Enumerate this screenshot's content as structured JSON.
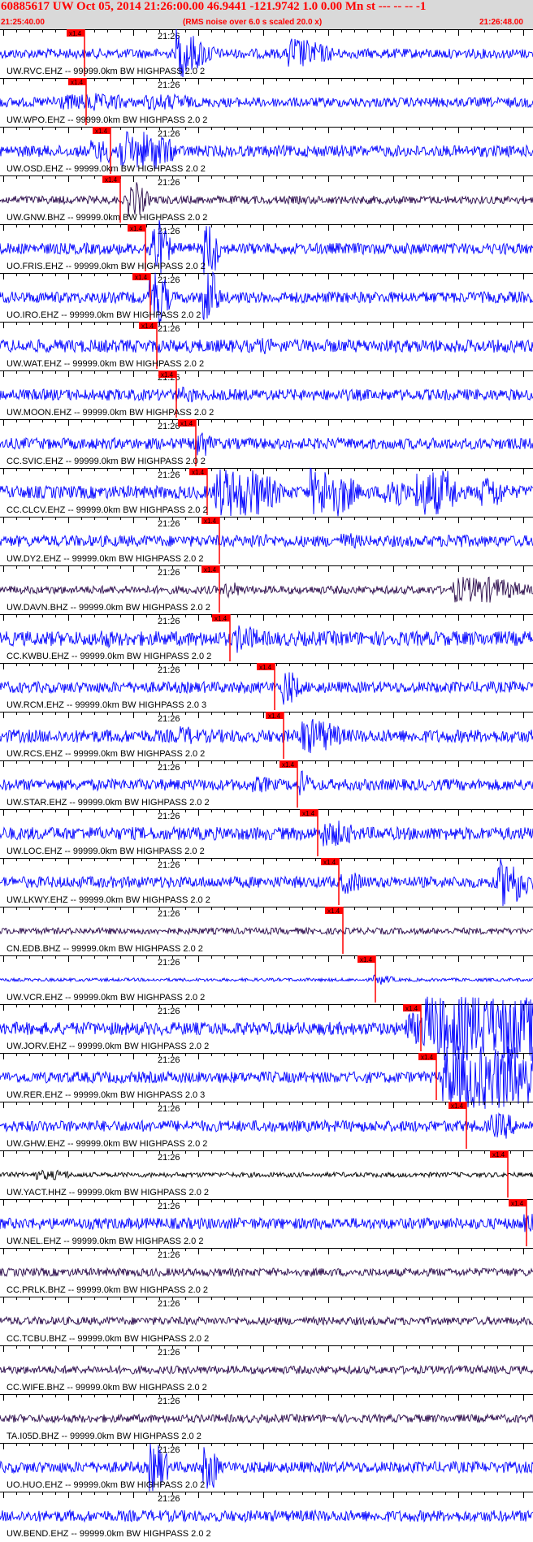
{
  "header": {
    "title": "60885617 UW Oct 05, 2014 21:26:00.00   46.9441 -121.9742  1.0 0.00 Mn st --- -- --  -1",
    "start_time": "21:25:40.00",
    "note": "(RMS noise over 6.0 s scaled 20.0 x)",
    "end_time": "21:26:48.00"
  },
  "time_marker_label": "21:26",
  "pick_label": "x1.4",
  "colors": {
    "header_bg": "#d9d9d9",
    "header_text": "#ff0000",
    "trace_blue": "#0000ff",
    "trace_dark": "#2a0a4a",
    "trace_black": "#000000",
    "pick": "#ff0000"
  },
  "traces": [
    {
      "label": "UW.RVC.EHZ -- 99999.0km BW  HIGHPASS  2.0  2",
      "pick_s": 15.8,
      "color": "blue",
      "amp": 6,
      "bursts": [
        [
          31,
          26,
          3,
          6
        ],
        [
          45,
          33,
          10,
          34
        ],
        [
          54,
          55,
          12,
          22
        ]
      ]
    },
    {
      "label": "UW.WPO.EHZ -- 99999.0km BW  HIGHPASS  2.0  2",
      "pick_s": 16.1,
      "color": "blue",
      "amp": 6,
      "bursts": [
        [
          18,
          17,
          4,
          16
        ],
        [
          10,
          22,
          6,
          10
        ],
        [
          27,
          35,
          2,
          10
        ]
      ]
    },
    {
      "label": "UW.OSD.EHZ -- 99999.0km BW  HIGHPASS  2.0  2",
      "pick_s": 20.8,
      "color": "blue",
      "amp": 7,
      "bursts": [
        [
          22,
          30,
          5,
          24
        ],
        [
          17,
          21,
          4,
          14
        ],
        [
          67,
          64,
          1,
          10
        ]
      ]
    },
    {
      "label": "UW.GNW.BHZ -- 99999.0km BW  HIGHPASS  2.0  2",
      "pick_s": 22.5,
      "color": "dark",
      "amp": 5,
      "bursts": [
        [
          24,
          26,
          3,
          22
        ]
      ]
    },
    {
      "label": "UO.FRIS.EHZ -- 99999.0km BW  HIGHPASS  2.0  2",
      "pick_s": 27.3,
      "color": "blue",
      "amp": 7,
      "bursts": [
        [
          28,
          30,
          3,
          36
        ],
        [
          38,
          40,
          2,
          34
        ]
      ]
    },
    {
      "label": "UO.IRO.EHZ -- 99999.0km BW  HIGHPASS  2.0  2",
      "pick_s": 28.2,
      "color": "blue",
      "amp": 7,
      "bursts": [
        [
          28,
          30,
          3,
          36
        ],
        [
          38,
          40,
          2,
          34
        ]
      ]
    },
    {
      "label": "UW.WAT.EHZ -- 99999.0km BW  HIGHPASS  2.0  2",
      "pick_s": 29.4,
      "color": "blue",
      "amp": 8,
      "bursts": [
        [
          48,
          50,
          10,
          10
        ]
      ]
    },
    {
      "label": "UW.MOON.EHZ -- 99999.0km BW  HIGHPASS  2.0  2",
      "pick_s": 33.1,
      "color": "blue",
      "amp": 7,
      "bursts": [
        [
          33,
          36,
          4,
          10
        ]
      ]
    },
    {
      "label": "CC.SVIC.EHZ -- 99999.0km BW  HIGHPASS  2.0  2",
      "pick_s": 36.8,
      "color": "blue",
      "amp": 7,
      "bursts": [
        [
          37,
          38,
          3,
          20
        ]
      ]
    },
    {
      "label": "CC.CLCV.EHZ -- 99999.0km BW  HIGHPASS  2.0  2",
      "pick_s": 38.8,
      "color": "blue",
      "amp": 8,
      "bursts": [
        [
          40,
          48,
          8,
          30
        ],
        [
          58,
          64,
          5,
          30
        ],
        [
          72,
          74,
          4,
          26
        ],
        [
          78,
          84,
          4,
          28
        ],
        [
          90,
          93,
          4,
          20
        ]
      ]
    },
    {
      "label": "UW.DY2.EHZ -- 99999.0km BW  HIGHPASS  2.0  2",
      "pick_s": 41.2,
      "color": "blue",
      "amp": 7,
      "bursts": [
        [
          47,
          49,
          6,
          10
        ],
        [
          64,
          66,
          6,
          10
        ],
        [
          84,
          86,
          6,
          10
        ]
      ]
    },
    {
      "label": "UW.DAVN.BHZ -- 99999.0km BW  HIGHPASS  2.0  2",
      "pick_s": 41.1,
      "color": "dark",
      "amp": 5,
      "bursts": [
        [
          42,
          44,
          3,
          10
        ],
        [
          85,
          92,
          12,
          16
        ]
      ]
    },
    {
      "label": "CC.KWBU.EHZ -- 99999.0km BW  HIGHPASS  2.0  2",
      "pick_s": 43.2,
      "color": "blue",
      "amp": 9,
      "bursts": [
        [
          44,
          46,
          6,
          18
        ],
        [
          18,
          20,
          6,
          12
        ]
      ]
    },
    {
      "label": "UW.RCM.EHZ -- 99999.0km BW  HIGHPASS  2.0  3",
      "pick_s": 51.6,
      "color": "blue",
      "amp": 7,
      "bursts": [
        [
          53,
          54,
          4,
          24
        ]
      ]
    },
    {
      "label": "UW.RCS.EHZ -- 99999.0km BW  HIGHPASS  2.0  2",
      "pick_s": 53.2,
      "color": "blue",
      "amp": 8,
      "bursts": [
        [
          56,
          60,
          8,
          22
        ],
        [
          33,
          36,
          3,
          12
        ]
      ]
    },
    {
      "label": "UW.STAR.EHZ -- 99999.0km BW  HIGHPASS  2.0  2",
      "pick_s": 55.8,
      "color": "blue",
      "amp": 7,
      "bursts": [
        [
          56,
          57,
          3,
          18
        ],
        [
          47,
          50,
          3,
          10
        ]
      ]
    },
    {
      "label": "UW.LOC.EHZ -- 99999.0km BW  HIGHPASS  2.0  2",
      "pick_s": 59.6,
      "color": "blue",
      "amp": 8,
      "bursts": [
        [
          60,
          64,
          6,
          16
        ]
      ]
    },
    {
      "label": "UW.LKWY.EHZ -- 99999.0km BW  HIGHPASS  2.0  2",
      "pick_s": 63.5,
      "color": "blue",
      "amp": 7,
      "bursts": [
        [
          64,
          66,
          6,
          14
        ],
        [
          93,
          96,
          6,
          30
        ]
      ]
    },
    {
      "label": "CN.EDB.BHZ -- 99999.0km BW  HIGHPASS  2.0  2",
      "pick_s": 64.4,
      "color": "dark",
      "amp": 4,
      "bursts": []
    },
    {
      "label": "UW.VCR.EHZ -- 99999.0km BW  HIGHPASS  2.0  2",
      "pick_s": 70.5,
      "color": "blue",
      "amp": 2,
      "bursts": [
        [
          70,
          72,
          4,
          6
        ]
      ]
    },
    {
      "label": "UW.JORV.EHZ -- 99999.0km BW  HIGHPASS  2.0  2",
      "pick_s": 78.9,
      "color": "blue",
      "amp": 8,
      "bursts": [
        [
          76,
          78,
          5,
          20
        ],
        [
          79,
          100,
          40,
          40
        ]
      ]
    },
    {
      "label": "UW.RER.EHZ -- 99999.0km BW  HIGHPASS  2.0  3",
      "pick_s": 81.8,
      "color": "blue",
      "amp": 7,
      "bursts": [
        [
          83,
          99,
          40,
          40
        ]
      ]
    },
    {
      "label": "UW.GHW.EHZ -- 99999.0km BW  HIGHPASS  2.0  2",
      "pick_s": 87.5,
      "color": "blue",
      "amp": 7,
      "bursts": [
        [
          92,
          95,
          4,
          16
        ]
      ]
    },
    {
      "label": "UW.YACT.HHZ -- 99999.0km BW  HIGHPASS  2.0  2",
      "pick_s": 95.3,
      "color": "black",
      "amp": 3,
      "bursts": [
        [
          6,
          12,
          3,
          6
        ]
      ]
    },
    {
      "label": "UW.NEL.EHZ -- 99999.0km BW  HIGHPASS  2.0  2",
      "pick_s": 98.8,
      "color": "blue",
      "amp": 7,
      "bursts": [
        [
          98,
          100,
          3,
          12
        ]
      ]
    },
    {
      "label": "CC.PRLK.BHZ -- 99999.0km BW  HIGHPASS  2.0  2",
      "pick_s": null,
      "color": "dark",
      "amp": 5,
      "bursts": []
    },
    {
      "label": "CC.TCBU.BHZ -- 99999.0km BW  HIGHPASS  2.0  2",
      "pick_s": null,
      "color": "dark",
      "amp": 5,
      "bursts": []
    },
    {
      "label": "CC.WIFE.BHZ -- 99999.0km BW  HIGHPASS  2.0  2",
      "pick_s": null,
      "color": "dark",
      "amp": 5,
      "bursts": []
    },
    {
      "label": "TA.I05D.BHZ -- 99999.0km BW  HIGHPASS  2.0  2",
      "pick_s": null,
      "color": "dark",
      "amp": 5,
      "bursts": []
    },
    {
      "label": "UO.HUO.EHZ -- 99999.0km BW  HIGHPASS  2.0  2",
      "pick_s": null,
      "color": "blue",
      "amp": 7,
      "bursts": [
        [
          28,
          30,
          3,
          30
        ],
        [
          38,
          40,
          2,
          28
        ]
      ]
    },
    {
      "label": "UW.BEND.EHZ -- 99999.0km BW  HIGHPASS  2.0  2",
      "pick_s": null,
      "color": "blue",
      "amp": 7,
      "bursts": []
    }
  ]
}
